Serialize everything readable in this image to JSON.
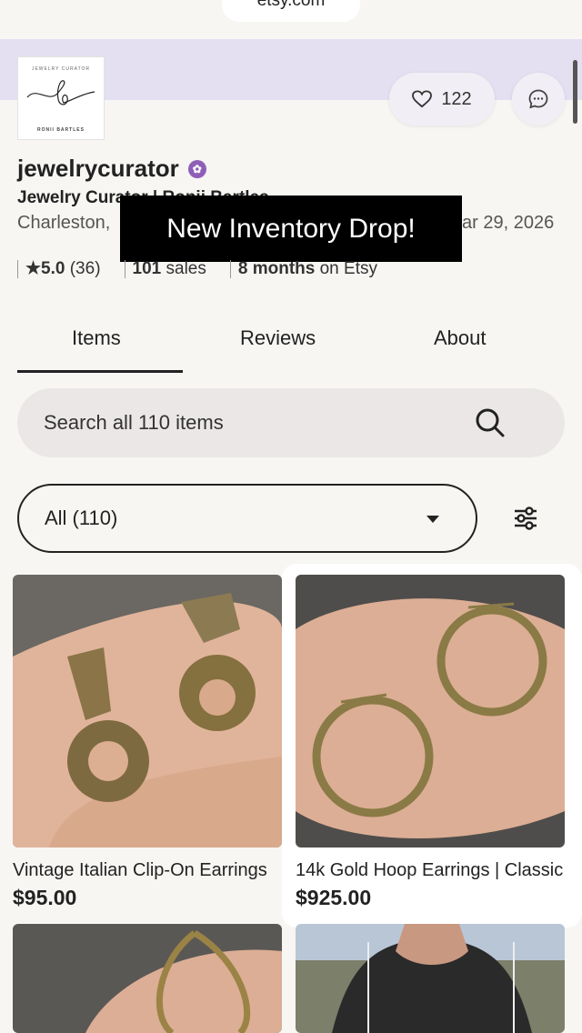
{
  "browser": {
    "url": "etsy.com"
  },
  "shop": {
    "name": "jewelrycurator",
    "title": "Jewelry Curator | Ronii Bartles",
    "location": "Charleston,",
    "date": "ar 29, 2026",
    "favorites": "122",
    "rating": "★5.0",
    "review_count": "(36)",
    "sales_num": "101",
    "sales_label": "sales",
    "tenure_num": "8 months",
    "tenure_label": "on Etsy",
    "logo_top": "JEWELRY CURATOR",
    "logo_bottom": "RONII BARTLES"
  },
  "overlay_text": "New Inventory Drop!",
  "tabs": [
    {
      "label": "Items",
      "active": true
    },
    {
      "label": "Reviews",
      "active": false
    },
    {
      "label": "About",
      "active": false
    }
  ],
  "search": {
    "placeholder": "Search all 110 items"
  },
  "filter": {
    "selected": "All (110)"
  },
  "listings": [
    {
      "title": "Vintage Italian Clip-On Earrings",
      "price": "$95.00"
    },
    {
      "title": "14k Gold Hoop Earrings | Classic",
      "price": "$925.00"
    },
    {
      "title": "",
      "price": ""
    },
    {
      "title": "",
      "price": ""
    }
  ],
  "colors": {
    "banner": "#e4e0f2",
    "accent": "#8f5fb8",
    "background": "#f7f6f3"
  },
  "icons": [
    "heart-icon",
    "chat-icon",
    "verified-badge-icon",
    "search-icon",
    "filter-sliders-icon",
    "chevron-down-icon"
  ]
}
